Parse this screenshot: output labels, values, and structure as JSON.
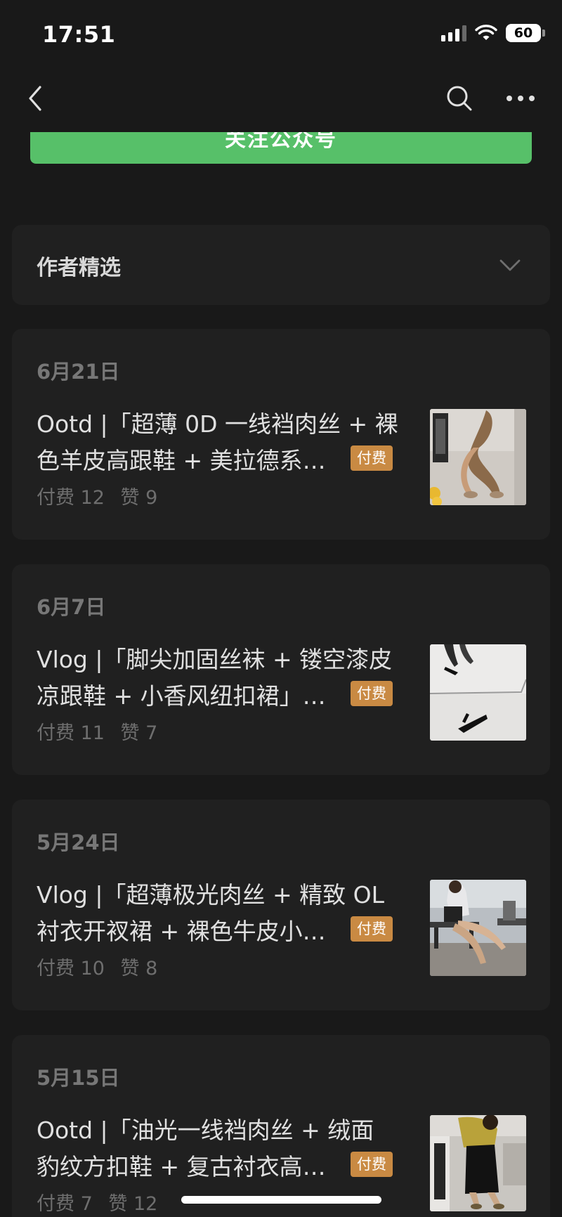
{
  "status_bar": {
    "time": "17:51",
    "battery": "60"
  },
  "nav": {
    "back_icon": "chevron-left-icon",
    "search_icon": "search-icon",
    "more_icon": "more-dots-icon"
  },
  "follow_button": {
    "label": "关注公众号",
    "color": "#57c069"
  },
  "author_picks": {
    "title": "作者精选",
    "chevron_icon": "chevron-down-icon"
  },
  "articles": [
    {
      "date": "6月21日",
      "title_line1": "Ootd |「超薄 0D 一线裆肉丝 + 裸",
      "title_line2": "色羊皮高跟鞋 + 美拉德系…",
      "badge": "付费",
      "paid_count": "付费 12",
      "likes": "赞 9"
    },
    {
      "date": "6月7日",
      "title_line1": "Vlog |「脚尖加固丝袜 + 镂空漆皮",
      "title_line2": "凉跟鞋 + 小香风纽扣裙」…",
      "badge": "付费",
      "paid_count": "付费 11",
      "likes": "赞 7"
    },
    {
      "date": "5月24日",
      "title_line1": "Vlog |「超薄极光肉丝 + 精致 OL",
      "title_line2": "衬衣开衩裙 + 裸色牛皮小…",
      "badge": "付费",
      "paid_count": "付费 10",
      "likes": "赞 8"
    },
    {
      "date": "5月15日",
      "title_line1": "Ootd |「油光一线裆肉丝 + 绒面",
      "title_line2": "豹纹方扣鞋 + 复古衬衣高…",
      "badge": "付费",
      "paid_count": "付费 7",
      "likes": "赞 12"
    }
  ],
  "colors": {
    "background": "#191919",
    "card": "#202020",
    "badge": "#c98a43",
    "accent_green": "#57c069"
  }
}
